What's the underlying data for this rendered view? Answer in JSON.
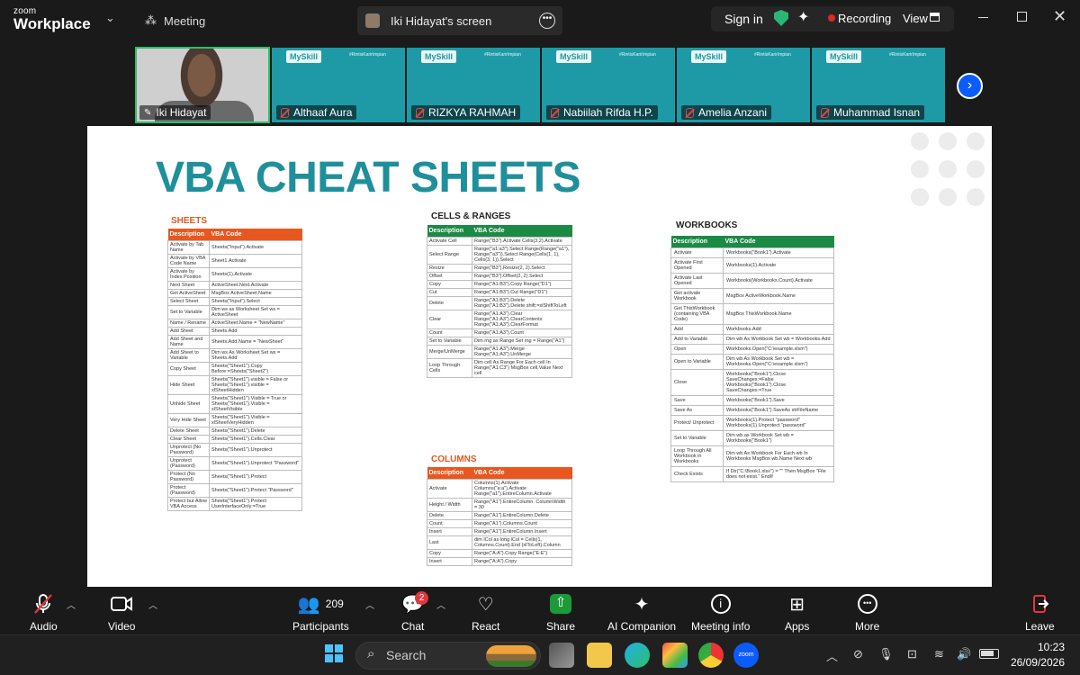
{
  "window": {
    "logo_small": "zoom",
    "logo_big": "Workplace",
    "meeting_menu": "Meeting",
    "share_title": "Iki Hidayat's screen",
    "sign_in": "Sign in",
    "recording": "Recording",
    "view": "View"
  },
  "participants": [
    {
      "name": "Iki Hidayat"
    },
    {
      "name": "Althaaf Aura",
      "brand": "MySkill",
      "tag": "#RintisKarirImpian"
    },
    {
      "name": "RIZKYA RAHMAH",
      "brand": "MySkill",
      "tag": "#RintisKarirImpian"
    },
    {
      "name": "Nabiilah Rifda H.P.",
      "brand": "MySkill",
      "tag": "#RintisKarirImpian"
    },
    {
      "name": "Amelia Anzani",
      "brand": "MySkill",
      "tag": "#RintisKarirImpian"
    },
    {
      "name": "Muhammad Isnan",
      "brand": "MySkill",
      "tag": "#RintisKarirImpian"
    }
  ],
  "slide": {
    "title": "VBA CHEAT SHEETS",
    "sections": {
      "sheets": "SHEETS",
      "cells": "CELLS & RANGES",
      "columns": "COLUMNS",
      "workbooks": "WORKBOOKS"
    },
    "col_desc": "Description",
    "col_code": "VBA Code",
    "sheets_rows": [
      [
        "Activate by Tab Name",
        "Sheets(\"Input\").Activate"
      ],
      [
        "Activate by VBA Code Name",
        "Sheet1.Activate"
      ],
      [
        "Activate by Index Position",
        "Sheets(1).Activate"
      ],
      [
        "Next Sheet",
        "ActiveSheet.Next.Activate"
      ],
      [
        "Get ActiveSheet",
        "MsgBox ActiveSheet.Name"
      ],
      [
        "Select Sheet",
        "Sheets(\"Input\").Select"
      ],
      [
        "Set to Variable",
        "Dim ws as Worksheet Set ws = ActiveSheet"
      ],
      [
        "Name / Rename",
        "ActiveSheet.Name = \"NewName\""
      ],
      [
        "Add Sheet",
        "Sheets.Add"
      ],
      [
        "Add Sheet and Name",
        "Sheets.Add.Name = \"NewSheet\""
      ],
      [
        "Add Sheet to Variable",
        "Dim ws As Worksheet Set ws = Sheets.Add"
      ],
      [
        "Copy Sheet",
        "Sheets(\"Sheet1\").Copy Before:=Sheets(\"Sheet2\")"
      ],
      [
        "Hide Sheet",
        "Sheets(\"Sheet1\").visible = False or Sheets(\"Sheet1\").visible = xlSheetHidden"
      ],
      [
        "Unhide Sheet",
        "Sheets(\"Sheet1\").Visible = True or Sheets(\"Sheet1\").Visible = xlSheetVisible"
      ],
      [
        "Very Hide Sheet",
        "Sheets(\"Sheet1\").Visible = xlSheetVeryHidden"
      ],
      [
        "Delete Sheet",
        "Sheets(\"Sheet1\").Delete"
      ],
      [
        "Clear Sheet",
        "Sheets(\"Sheet1\").Cells.Clear"
      ],
      [
        "Unprotect (No Password)",
        "Sheets(\"Sheet1\").Unprotect"
      ],
      [
        "Unprotect (Password)",
        "Sheets(\"Sheet1\").Unprotect \"Password\""
      ],
      [
        "Protect (No Password)",
        "Sheets(\"Sheet1\").Protect"
      ],
      [
        "Protect (Password)",
        "Sheets(\"Sheet1\").Protect \"Password\""
      ],
      [
        "Protect but Allow VBA Access",
        "Sheets(\"Sheet1\").Protect UserInterfaceOnly:=True"
      ]
    ],
    "cells_rows": [
      [
        "Activate Cell",
        "Range(\"B3\").Activate Cells(3,2).Activate"
      ],
      [
        "Select Range",
        "Range(\"a1:a3\").Select Range(Range(\"a1\"), Range(\"a3\")).Select Range(Cells(1, 1), Cells(3, 1)).Select"
      ],
      [
        "Resize",
        "Range(\"B3\").Resize(2, 2).Select"
      ],
      [
        "Offset",
        "Range(\"B3\").Offset(2, 2).Select"
      ],
      [
        "Copy",
        "Range(\"A1:B3\").Copy Range(\"D1\")"
      ],
      [
        "Cut",
        "Range(\"A1:B3\").Cut Range(\"D1\")"
      ],
      [
        "Delete",
        "Range(\"A1:B3\").Delete Range(\"A1:B3\").Delete shift:=xlShiftToLeft"
      ],
      [
        "Clear",
        "Range(\"A1:A3\").Clear Range(\"A1:A3\").ClearContents Range(\"A1:A3\").ClearFormat"
      ],
      [
        "Count",
        "Range(\"A1:A3\").Count"
      ],
      [
        "Set to Variable",
        "Dim rng as Range Set rng = Range(\"A1\")"
      ],
      [
        "Merge/UnMerge",
        "Range(\"A1:A3\").Merge Range(\"A1:A3\").UnMerge"
      ],
      [
        "Loop Through Cells",
        "Dim cell As Range For Each cell In Range(\"A1:C3\") MsgBox cell.Value Next cell"
      ]
    ],
    "cols_rows": [
      [
        "Activate",
        "Columns(1).Activate Columns(\"a:a\").Activate Range(\"a1\").EntireColumn.Activate"
      ],
      [
        "Height / Width",
        "Range(\"A1\").EntireColumn. ColumnWidth = 30"
      ],
      [
        "Delete",
        "Range(\"A1\").EntireColumn.Delete"
      ],
      [
        "Count",
        "Range(\"A1\").Columns.Count"
      ],
      [
        "Insert",
        "Range(\"A1\").EntireColumn.Insert"
      ],
      [
        "Last",
        "dim lCol as long lCol = Cells(1, Columns.Count).End (xlToLeft).Column"
      ],
      [
        "Copy",
        "Range(\"A:A\").Copy Range(\"E:E\")"
      ],
      [
        "Insert",
        "Range(\"A:A\").Copy"
      ]
    ],
    "wb_rows": [
      [
        "Activate",
        "Workbooks(\"Book1\").Activate"
      ],
      [
        "Activate First Opened",
        "Workbooks(1).Activate"
      ],
      [
        "Activate Last Opened",
        "Workbooks(Workbooks.Count).Activate"
      ],
      [
        "Get activate Workbook",
        "MsgBox ActiveWorkbook.Name"
      ],
      [
        "Get ThisWorkbook (containing VBA Code)",
        "MsgBox ThisWorkbook.Name"
      ],
      [
        "Add",
        "Workbooks.Add"
      ],
      [
        "Add to Variable",
        "Dim wb As Workbook Set wb = Workbooks.Add"
      ],
      [
        "Open",
        "Workbooks.Open(\"C:\\example.xlsm\")"
      ],
      [
        "Open to Variable",
        "Dim wb As Workbook Set wb = Workbooks.Open(\"C:\\example.xlsm\")"
      ],
      [
        "Close",
        "Workbooks(\"Book1\").Close SaveChanges:=False Workbooks(\"Book1\").Close SaveChanges:=True"
      ],
      [
        "Save",
        "Workbooks(\"Book1\").Save"
      ],
      [
        "Save As",
        "Workbooks(\"Book1\").SaveAs strFileName"
      ],
      [
        "Protect/ Unprotect",
        "Workbooks(1).Protect \"password\" Workbooks(1).Unprotect \"password\""
      ],
      [
        "Set to Variable",
        "Dim wb as Workbook Set wb = Workbooks(\"Book1\")"
      ],
      [
        "Loop Through All Workbook in Workbooks",
        "Dim wb As Workbook For Each wb In Workbooks MsgBox wb.Name Next wb"
      ],
      [
        "Check Exists",
        "If Dir(\"C:\\Book1.xlsx\") = \"\" Then MsgBox \"File does not exist.\" EndIf"
      ]
    ]
  },
  "toolbar": {
    "audio": "Audio",
    "video": "Video",
    "participants_count": "209",
    "participants": "Participants",
    "chat": "Chat",
    "chat_badge": "2",
    "react": "React",
    "share": "Share",
    "ai": "AI Companion",
    "info": "Meeting info",
    "apps": "Apps",
    "more": "More",
    "leave": "Leave"
  },
  "taskbar": {
    "search": "Search",
    "time": "10:23",
    "date": "26/09/2026"
  },
  "colors": {
    "accent": "#1f8f9b",
    "share_green": "#1b9a3a",
    "leave_red": "#e0383e",
    "orange": "#e8571f",
    "green": "#1b8a45"
  }
}
